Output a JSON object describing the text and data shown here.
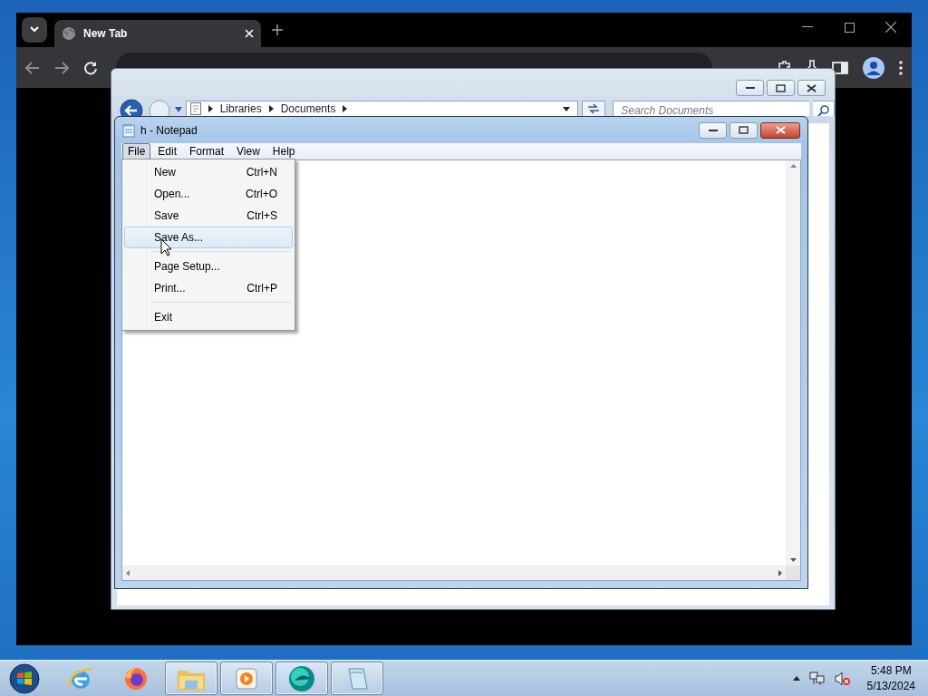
{
  "browser": {
    "tabs": [
      {
        "label": "New Tab",
        "selected": true
      }
    ]
  },
  "explorer": {
    "breadcrumb": [
      "Libraries",
      "Documents"
    ],
    "search": {
      "placeholder": "Search Documents"
    }
  },
  "notepad": {
    "title": "h - Notepad",
    "menu": [
      {
        "label": "File",
        "selected": true
      },
      {
        "label": "Edit",
        "selected": false
      },
      {
        "label": "Format",
        "selected": false
      },
      {
        "label": "View",
        "selected": false
      },
      {
        "label": "Help",
        "selected": false
      }
    ],
    "file_menu": [
      {
        "kind": "item",
        "label": "New",
        "shortcut": "Ctrl+N",
        "selected": false
      },
      {
        "kind": "item",
        "label": "Open...",
        "shortcut": "Ctrl+O",
        "selected": false
      },
      {
        "kind": "item",
        "label": "Save",
        "shortcut": "Ctrl+S",
        "selected": false
      },
      {
        "kind": "item",
        "label": "Save As...",
        "selected": true
      },
      {
        "kind": "separator"
      },
      {
        "kind": "item",
        "label": "Page Setup...",
        "selected": false
      },
      {
        "kind": "item",
        "label": "Print...",
        "shortcut": "Ctrl+P",
        "selected": false
      },
      {
        "kind": "separator"
      },
      {
        "kind": "item",
        "label": "Exit",
        "selected": false
      }
    ]
  },
  "taskbar": {
    "apps": [
      {
        "kind": "ie",
        "running": false
      },
      {
        "kind": "firefox",
        "running": false
      },
      {
        "kind": "folder",
        "running": true
      },
      {
        "kind": "media",
        "running": true
      },
      {
        "kind": "orb",
        "running": true
      },
      {
        "kind": "notepad",
        "running": true
      }
    ],
    "clock": {
      "time": "5:48 PM",
      "date": "5/13/2024"
    }
  }
}
